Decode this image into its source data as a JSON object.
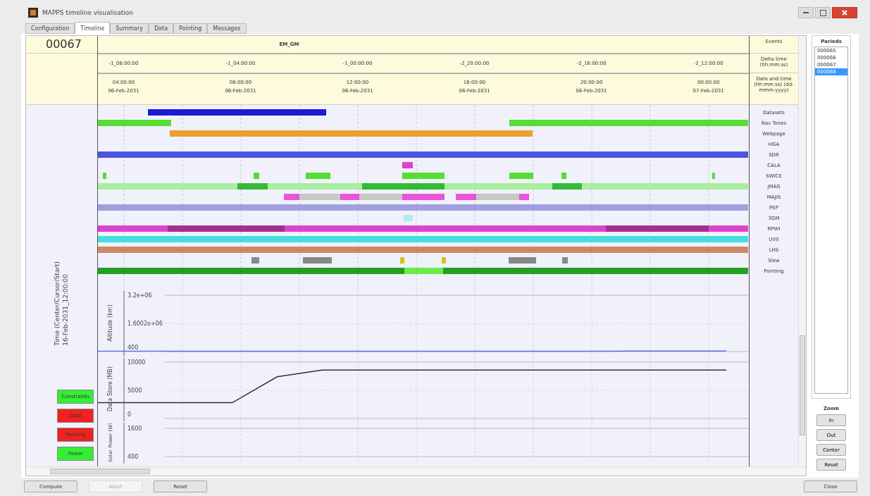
{
  "window": {
    "title": "MAPPS timeline visualisation"
  },
  "tabs": [
    {
      "label": "Configuration",
      "selected": false
    },
    {
      "label": "Timeline",
      "selected": true
    },
    {
      "label": "Summary",
      "selected": false
    },
    {
      "label": "Data",
      "selected": false
    },
    {
      "label": "Pointing",
      "selected": false
    },
    {
      "label": "Messages",
      "selected": false
    }
  ],
  "header": {
    "period": "00067",
    "events": [
      "EM_GM"
    ],
    "delta_ticks": [
      "-1_08:00:00",
      "-1_04:00:00",
      "-1_00:00:00",
      "-2_20:00:00",
      "-2_16:00:00",
      "-2_12:00:00"
    ],
    "date_ticks": [
      {
        "clock": "04:00:00",
        "date": "06-Feb-2031"
      },
      {
        "clock": "08:00:00",
        "date": "06-Feb-2031"
      },
      {
        "clock": "12:00:00",
        "date": "06-Feb-2031"
      },
      {
        "clock": "16:00:00",
        "date": "06-Feb-2031"
      },
      {
        "clock": "20:00:00",
        "date": "06-Feb-2031"
      },
      {
        "clock": "00:00:00",
        "date": "07-Feb-2031"
      }
    ],
    "labels": [
      "Events",
      "Delta time (hh:mm:ss)",
      "Date and time (hh:mm:ss) (dd-mmm-yyyy)"
    ]
  },
  "tracks": [
    "Datasets",
    "Nav Tones",
    "Webpage",
    "HGA",
    "SDR",
    "CALA",
    "SWICE",
    "JMAG",
    "MAJIS",
    "PEP",
    "3GM",
    "RPWI",
    "UVS",
    "LHS",
    "Slew",
    "Pointing"
  ],
  "side_caption": [
    "Time (Center/Cursor/Start)",
    "16-Feb-2031_12:00:00"
  ],
  "plots": [
    {
      "chart_data": {
        "type": "line",
        "grid": true,
        "ylabel": "Altitude (km)",
        "ylim": [
          400,
          3200000
        ],
        "yticks": [
          {
            "value": 3200000,
            "label": "3.2e+06"
          },
          {
            "value": 1600200,
            "label": "1.6002e+06"
          },
          400
        ],
        "categories": [
          null,
          null,
          null,
          null,
          null,
          null,
          null,
          null,
          null,
          null,
          null,
          null,
          null
        ],
        "series": [
          {
            "color": "#6070e8",
            "values": [
              16400,
              17400,
              18400,
              19400,
              20400,
              21400,
              22400,
              23400,
              24400,
              25400,
              26400,
              27400,
              28400
            ]
          }
        ]
      }
    },
    {
      "chart_data": {
        "type": "line",
        "grid": true,
        "ylabel": "Data Store (MB)",
        "ylim": [
          0,
          10000
        ],
        "yticks": [
          {
            "value": 10000,
            "label": "10000"
          },
          {
            "value": 5000,
            "label": "5000"
          },
          0
        ],
        "categories": [
          null,
          null,
          null,
          null,
          null,
          null,
          null,
          null,
          null,
          null,
          null,
          null,
          null
        ],
        "series": [
          {
            "color": "#333333",
            "values": [
              2800,
              2800,
              7400,
              8600,
              8600,
              8600,
              8600,
              8600,
              8600,
              8600,
              8600,
              8600,
              8600
            ]
          }
        ]
      }
    },
    {
      "ylabel": "Solar Power (W)",
      "ticks": [
        "1600",
        "400"
      ]
    }
  ],
  "status": [
    {
      "label": "Constraints",
      "ok": true
    },
    {
      "label": "Data",
      "ok": false
    },
    {
      "label": "Pointing",
      "ok": false
    },
    {
      "label": "Power",
      "ok": true
    }
  ],
  "periods": {
    "title": "Periods",
    "items": [
      {
        "label": "000065",
        "selected": false
      },
      {
        "label": "000066",
        "selected": false
      },
      {
        "label": "000067",
        "selected": false
      },
      {
        "label": "000068",
        "selected": true
      }
    ]
  },
  "zoom": {
    "title": "Zoom",
    "buttons": [
      "In",
      "Out",
      "Center",
      "Reset"
    ]
  },
  "footer": [
    {
      "label": "Compute",
      "disabled": false
    },
    {
      "label": "Abort",
      "disabled": true
    },
    {
      "label": "Reset",
      "disabled": false
    }
  ],
  "close_button": "Close"
}
